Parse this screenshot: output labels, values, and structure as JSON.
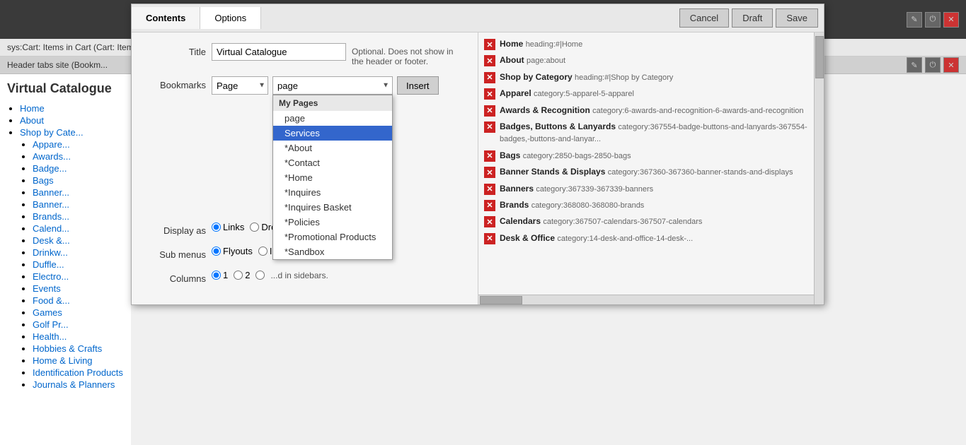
{
  "topBar": {
    "icons": [
      "✎",
      "⏻",
      "✕"
    ]
  },
  "sysBar": {
    "text": "sys:Cart: Items in Cart (Cart: Items In Cart)"
  },
  "secondBar": {
    "text": "Header tabs site (Bookm...",
    "icons": [
      "✎",
      "⏻",
      "✕"
    ]
  },
  "sidebar": {
    "title": "Virtual Catalogue",
    "topLinks": [
      "Home",
      "About",
      "Shop by Cate..."
    ],
    "subItems": [
      "Appare...",
      "Awards...",
      "Badge...",
      "Bags",
      "Banner...",
      "Banner...",
      "Brands...",
      "Calend...",
      "Desk &...",
      "Drinkw...",
      "Duffle...",
      "Electro...",
      "Events",
      "Food &...",
      "Games",
      "Golf Pr...",
      "Health...",
      "Hobbies & Crafts",
      "Home & Living",
      "Identification Products",
      "Journals & Planners"
    ]
  },
  "modal": {
    "tabs": [
      "Contents",
      "Options"
    ],
    "activeTab": "Contents",
    "buttons": {
      "cancel": "Cancel",
      "draft": "Draft",
      "save": "Save"
    },
    "form": {
      "titleLabel": "Title",
      "titleValue": "Virtual Catalogue",
      "titleHint": "Optional. Does not show in the header or footer.",
      "bookmarksLabel": "Bookmarks",
      "pageTypeOptions": [
        "Page"
      ],
      "pageDropdownDefault": "page",
      "pageDropdownOptions": {
        "groupLabel": "My Pages",
        "items": [
          "page",
          "Services",
          "*About",
          "*Contact",
          "*Home",
          "*Inquires",
          "*Inquires Basket",
          "*Policies",
          "*Promotional Products",
          "*Sandbox"
        ]
      },
      "selectedDropdownItem": "Services",
      "insertButton": "Insert",
      "displayAsLabel": "Display as",
      "displayAsOptions": [
        "Links",
        "Dro..."
      ],
      "subMenusLabel": "Sub menus",
      "subMenusOptions": [
        "Flyouts",
        "In..."
      ],
      "columnsLabel": "Columns",
      "columnsOptions": [
        "1",
        "2"
      ],
      "columnsHint": "...d in sidebars."
    },
    "listItems": [
      {
        "name": "Home",
        "path": "heading:#|Home"
      },
      {
        "name": "About",
        "path": "page:about"
      },
      {
        "name": "Shop by Category",
        "path": "heading:#|Shop by Category"
      },
      {
        "name": "Apparel",
        "path": "category:5-apparel-5-apparel"
      },
      {
        "name": "Awards & Recognition",
        "path": "category:6-awards-and-recognition-6-awards-and-recognition"
      },
      {
        "name": "Badges, Buttons & Lanyards",
        "path": "category:367554-badge-buttons-and-lanyards-367554-badges,-buttons-and-lanyar..."
      },
      {
        "name": "Bags",
        "path": "category:2850-bags-2850-bags"
      },
      {
        "name": "Banner Stands & Displays",
        "path": "category:367360-367360-banner-stands-and-displays"
      },
      {
        "name": "Banners",
        "path": "category:367339-367339-banners"
      },
      {
        "name": "Brands",
        "path": "category:368080-368080-brands"
      },
      {
        "name": "Calendars",
        "path": "category:367507-calendars-367507-calendars"
      },
      {
        "name": "Desk & Office",
        "path": "category:14-desk-and-office-14-desk-..."
      }
    ]
  }
}
